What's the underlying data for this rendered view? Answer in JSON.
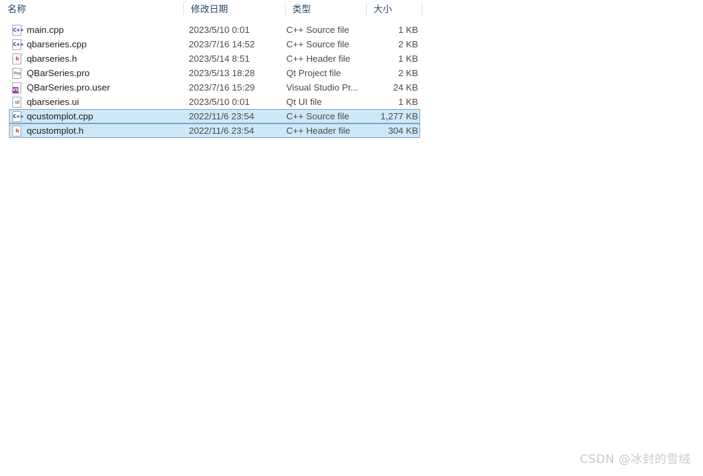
{
  "file_list": {
    "sort_indicator_icon": "chevron-up-icon",
    "sort_indicator_glyph": "▲",
    "columns": [
      {
        "key": "name",
        "label": "名称"
      },
      {
        "key": "date",
        "label": "修改日期"
      },
      {
        "key": "type",
        "label": "类型"
      },
      {
        "key": "size",
        "label": "大小"
      }
    ],
    "rows": [
      {
        "icon": "cpp-source-file-icon",
        "icon_tag": "C++",
        "icon_kind": "cpp",
        "name": "main.cpp",
        "date": "2023/5/10 0:01",
        "type": "C++ Source file",
        "size": "1 KB",
        "selected": false
      },
      {
        "icon": "cpp-source-file-icon",
        "icon_tag": "C++",
        "icon_kind": "cpp",
        "name": "qbarseries.cpp",
        "date": "2023/7/16 14:52",
        "type": "C++ Source file",
        "size": "2 KB",
        "selected": false
      },
      {
        "icon": "cpp-header-file-icon",
        "icon_tag": "h",
        "icon_kind": "h",
        "name": "qbarseries.h",
        "date": "2023/5/14 8:51",
        "type": "C++ Header file",
        "size": "1 KB",
        "selected": false
      },
      {
        "icon": "qt-project-file-icon",
        "icon_tag": "Pro",
        "icon_kind": "pro",
        "name": "QBarSeries.pro",
        "date": "2023/5/13 18:28",
        "type": "Qt Project file",
        "size": "2 KB",
        "selected": false
      },
      {
        "icon": "visual-studio-project-user-file-icon",
        "icon_tag": "",
        "icon_kind": "vsuser",
        "name": "QBarSeries.pro.user",
        "date": "2023/7/16 15:29",
        "type": "Visual Studio Pr...",
        "size": "24 KB",
        "selected": false
      },
      {
        "icon": "qt-ui-file-icon",
        "icon_tag": "ui",
        "icon_kind": "ui",
        "name": "qbarseries.ui",
        "date": "2023/5/10 0:01",
        "type": "Qt UI file",
        "size": "1 KB",
        "selected": false
      },
      {
        "icon": "cpp-source-file-icon",
        "icon_tag": "C++",
        "icon_kind": "cpp",
        "name": "qcustomplot.cpp",
        "date": "2022/11/6 23:54",
        "type": "C++ Source file",
        "size": "1,277 KB",
        "selected": true
      },
      {
        "icon": "cpp-header-file-icon",
        "icon_tag": "h",
        "icon_kind": "h",
        "name": "qcustomplot.h",
        "date": "2022/11/6 23:54",
        "type": "C++ Header file",
        "size": "304 KB",
        "selected": true
      }
    ]
  },
  "watermark": {
    "text": "CSDN @冰封的雪绒"
  },
  "colors": {
    "selection_fill": "#cde8f7",
    "selection_border": "#7da2ce",
    "header_text": "#26486b",
    "body_text": "#4a4a4a",
    "watermark_text": "#c9c9c9"
  }
}
